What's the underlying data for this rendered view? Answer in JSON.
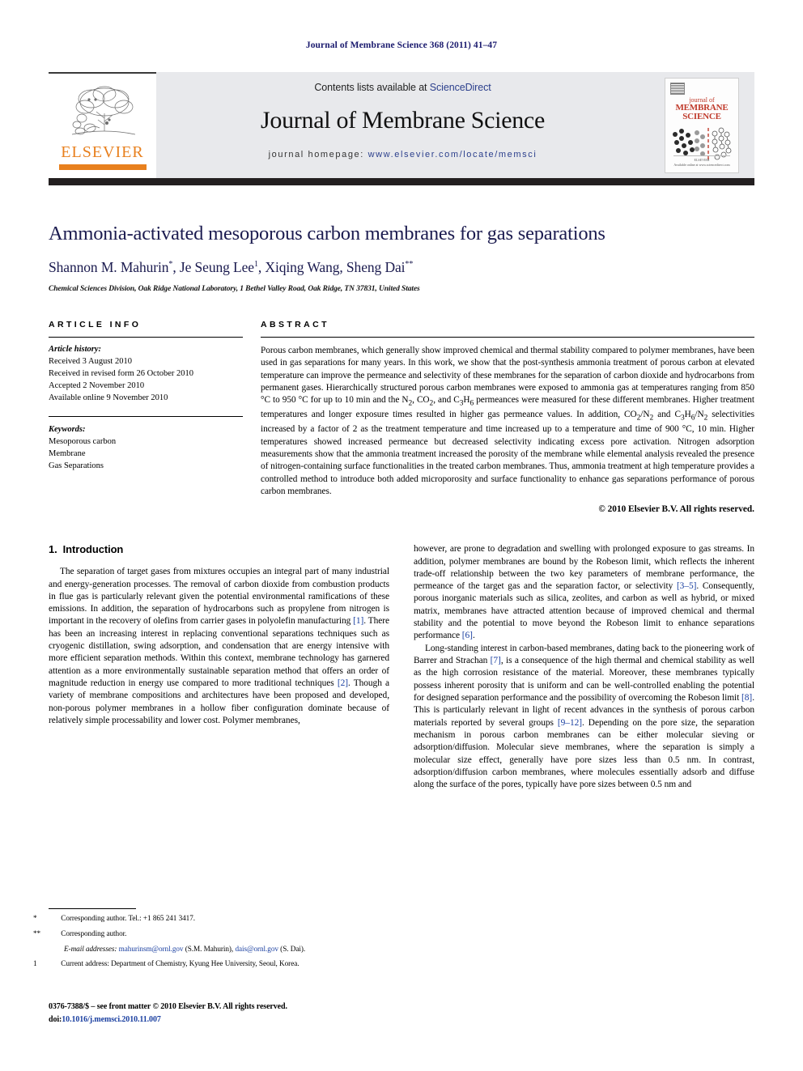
{
  "running_head": "Journal of Membrane Science 368 (2011) 41–47",
  "masthead": {
    "contents_prefix": "Contents lists available at ",
    "sciencedirect": "ScienceDirect",
    "journal_title": "Journal of Membrane Science",
    "homepage_prefix": "journal homepage: ",
    "homepage_url": "www.elsevier.com/locate/memsci",
    "publisher_name": "ELSEVIER",
    "publisher_accent": "#e8801e",
    "cover": {
      "line1": "journal of",
      "line2": "MEMBRANE",
      "line3": "SCIENCE",
      "imprint": "ELSEVIER",
      "tagline": "Available online at www.sciencedirect.com"
    }
  },
  "article": {
    "title": "Ammonia-activated mesoporous carbon membranes for gas separations",
    "authors_html": "Shannon M. Mahurin<sup>*</sup>, Je Seung Lee<sup>1</sup>, Xiqing Wang, Sheng Dai<sup>**</sup>",
    "affiliation": "Chemical Sciences Division, Oak Ridge National Laboratory, 1 Bethel Valley Road, Oak Ridge, TN 37831, United States",
    "title_color": "#1b1b4f"
  },
  "article_info": {
    "heading": "ARTICLE INFO",
    "history_label": "Article history:",
    "history": [
      "Received 3 August 2010",
      "Received in revised form 26 October 2010",
      "Accepted 2 November 2010",
      "Available online 9 November 2010"
    ],
    "keywords_label": "Keywords:",
    "keywords": [
      "Mesoporous carbon",
      "Membrane",
      "Gas Separations"
    ]
  },
  "abstract": {
    "heading": "ABSTRACT",
    "text": "Porous carbon membranes, which generally show improved chemical and thermal stability compared to polymer membranes, have been used in gas separations for many years. In this work, we show that the post-synthesis ammonia treatment of porous carbon at elevated temperature can improve the permeance and selectivity of these membranes for the separation of carbon dioxide and hydrocarbons from permanent gases. Hierarchically structured porous carbon membranes were exposed to ammonia gas at temperatures ranging from 850 °C to 950 °C for up to 10 min and the N2, CO2, and C3H6 permeances were measured for these different membranes. Higher treatment temperatures and longer exposure times resulted in higher gas permeance values. In addition, CO2/N2 and C3H6/N2 selectivities increased by a factor of 2 as the treatment temperature and time increased up to a temperature and time of 900 °C, 10 min. Higher temperatures showed increased permeance but decreased selectivity indicating excess pore activation. Nitrogen adsorption measurements show that the ammonia treatment increased the porosity of the membrane while elemental analysis revealed the presence of nitrogen-containing surface functionalities in the treated carbon membranes. Thus, ammonia treatment at high temperature provides a controlled method to introduce both added microporosity and surface functionality to enhance gas separations performance of porous carbon membranes.",
    "copyright": "© 2010 Elsevier B.V. All rights reserved."
  },
  "sections": {
    "intro_number": "1.",
    "intro_title": "Introduction"
  },
  "body": {
    "left_p1_a": "The separation of target gases from mixtures occupies an integral part of many industrial and energy-generation processes. The removal of carbon dioxide from combustion products in flue gas is particularly relevant given the potential environmental ramifications of these emissions. In addition, the separation of hydrocarbons such as propylene from nitrogen is important in the recovery of olefins from carrier gases in polyolefin manufacturing ",
    "left_cite_1": "[1]",
    "left_p1_b": ". There has been an increasing interest in replacing conventional separations techniques such as cryogenic distillation, swing adsorption, and condensation that are energy intensive with more efficient separation methods. Within this context, membrane technology has garnered attention as a more environmentally sustainable separation method that offers an order of magnitude reduction in energy use compared to more traditional techniques ",
    "left_cite_2": "[2]",
    "left_p1_c": ". Though a variety of membrane compositions and architectures have been proposed and developed, non-porous polymer membranes in a hollow fiber configuration dominate because of relatively simple processability and lower cost. Polymer membranes,",
    "right_p1_a": "however, are prone to degradation and swelling with prolonged exposure to gas streams. In addition, polymer membranes are bound by the Robeson limit, which reflects the inherent trade-off relationship between the two key parameters of membrane performance, the permeance of the target gas and the separation factor, or selectivity ",
    "right_cite_1": "[3–5]",
    "right_p1_b": ". Consequently, porous inorganic materials such as silica, zeolites, and carbon as well as hybrid, or mixed matrix, membranes have attracted attention because of improved chemical and thermal stability and the potential to move beyond the Robeson limit to enhance separations performance ",
    "right_cite_2": "[6]",
    "right_p1_c": ".",
    "right_p2_a": "Long-standing interest in carbon-based membranes, dating back to the pioneering work of Barrer and Strachan ",
    "right_cite_3": "[7]",
    "right_p2_b": ", is a consequence of the high thermal and chemical stability as well as the high corrosion resistance of the material. Moreover, these membranes typically possess inherent porosity that is uniform and can be well-controlled enabling the potential for designed separation performance and the possibility of overcoming the Robeson limit ",
    "right_cite_4": "[8]",
    "right_p2_c": ". This is particularly relevant in light of recent advances in the synthesis of porous carbon materials reported by several groups ",
    "right_cite_5": "[9–12]",
    "right_p2_d": ". Depending on the pore size, the separation mechanism in porous carbon membranes can be either molecular sieving or adsorption/diffusion. Molecular sieve membranes, where the separation is simply a molecular size effect, generally have pore sizes less than 0.5 nm. In contrast, adsorption/diffusion carbon membranes, where molecules essentially adsorb and diffuse along the surface of the pores, typically have pore sizes between 0.5 nm and"
  },
  "footnotes": {
    "corresponding_1_mark": "*",
    "corresponding_1": "Corresponding author. Tel.: +1 865 241 3417.",
    "corresponding_2_mark": "**",
    "corresponding_2": "Corresponding author.",
    "email_label": "E-mail addresses:",
    "email_1": "mahurinsm@ornl.gov",
    "email_1_person": " (S.M. Mahurin), ",
    "email_2": "dais@ornl.gov",
    "email_2_person": " (S. Dai).",
    "current_address_mark": "1",
    "current_address": "Current address: Department of Chemistry, Kyung Hee University, Seoul, Korea."
  },
  "imprint": {
    "line1": "0376-7388/$ – see front matter © 2010 Elsevier B.V. All rights reserved.",
    "doi_label": "doi:",
    "doi_value": "10.1016/j.memsci.2010.11.007"
  }
}
